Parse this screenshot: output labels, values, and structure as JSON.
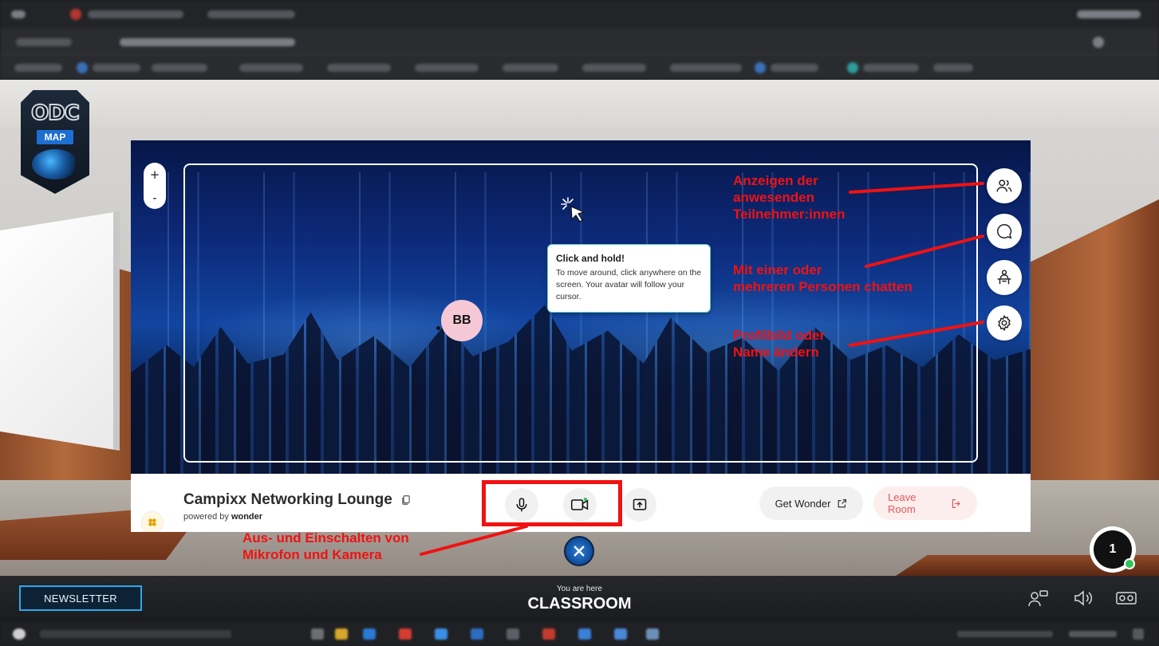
{
  "map_logo": {
    "brand": "ODC",
    "label": "MAP"
  },
  "wonder": {
    "zoom_in": "+",
    "zoom_out": "-",
    "tooltip": {
      "title": "Click and hold!",
      "body": "To move around, click anywhere on the screen. Your avatar will follow your cursor."
    },
    "avatar_initials": "BB",
    "room_name": "Campixx Networking Lounge",
    "powered_by_prefix": "powered by",
    "powered_by_brand": "wonder",
    "get_wonder_label": "Get Wonder",
    "leave_room_label": "Leave Room"
  },
  "annotations": {
    "participants": [
      "Anzeigen der",
      "anwesenden",
      "Teilnehmer:innen"
    ],
    "chat": [
      "Mit einer oder",
      "mehreren Personen chatten"
    ],
    "profile": [
      "Profilbild oder",
      "Name ändern"
    ],
    "av": [
      "Aus- und Einschalten von",
      "Mikrofon und Kamera"
    ]
  },
  "participants_count": "1",
  "bottom_bar": {
    "newsletter_label": "NEWSLETTER",
    "you_are_here": "You are here",
    "location": "CLASSROOM"
  },
  "colors": {
    "annotation_red": "#f01212",
    "leave_room": "#e4575a",
    "newsletter_border": "#2fa8ee",
    "online": "#2ec45a"
  }
}
